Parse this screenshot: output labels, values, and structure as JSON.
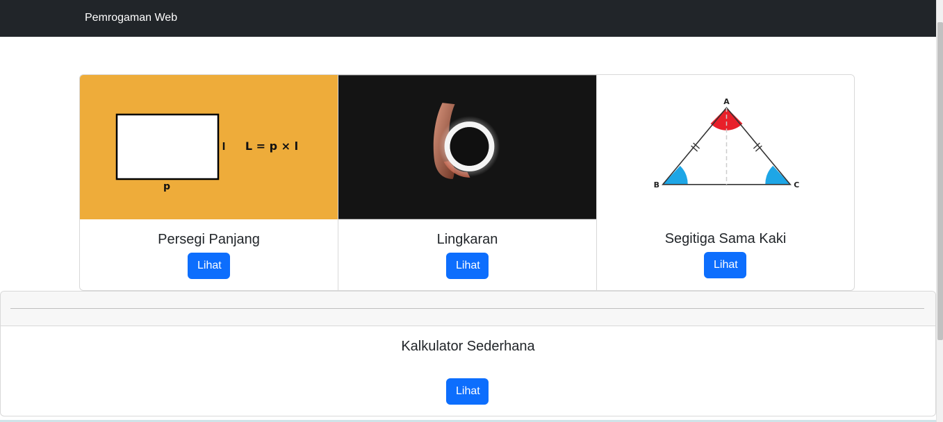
{
  "navbar": {
    "brand": "Pemrogaman Web"
  },
  "cards": [
    {
      "title": "Persegi Panjang",
      "button": "Lihat",
      "image": {
        "formula": "L = p × l",
        "label_length": "p",
        "label_width": "l",
        "background": "#eeac3a"
      }
    },
    {
      "title": "Lingkaran",
      "button": "Lihat",
      "image": {
        "background": "#141414"
      }
    },
    {
      "title": "Segitiga Sama Kaki",
      "button": "Lihat",
      "image": {
        "vertex_a": "A",
        "vertex_b": "B",
        "vertex_c": "C"
      }
    }
  ],
  "footer": {
    "title": "Kalkulator Sederhana",
    "button": "Lihat"
  },
  "colors": {
    "primary": "#0d6efd",
    "navbar": "#212529",
    "angle_red": "#e8202a",
    "angle_blue": "#1ea6e6"
  }
}
